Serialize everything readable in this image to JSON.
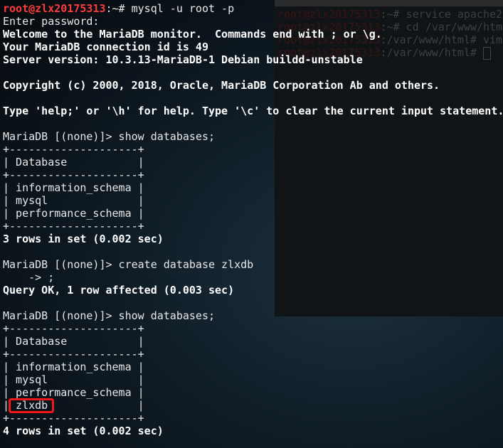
{
  "background_terminal": {
    "lines": [
      {
        "prompt": "root@zlx20175313",
        "rest": ":~# service apache2"
      },
      {
        "prompt": "root@zlx20175313",
        "rest": ":~# cd /var/www/html"
      },
      {
        "prompt": "root@zlx20175313",
        "rest": ":/var/www/html# vim"
      },
      {
        "prompt": "root@zlx20175313",
        "rest": ":/var/www/html# "
      }
    ]
  },
  "terminal": {
    "highlight_color": "#f01818",
    "lines": [
      {
        "prompt": "root@zlx20175313",
        "text": ":~# mysql -u root -p",
        "bold": false
      },
      {
        "text": "Enter password:",
        "bold": false
      },
      {
        "text": "Welcome to the MariaDB monitor.  Commands end with ; or \\g.",
        "bold": true
      },
      {
        "text": "Your MariaDB connection id is 49",
        "bold": true
      },
      {
        "text": "Server version: 10.3.13-MariaDB-1 Debian buildd-unstable",
        "bold": true
      },
      {
        "text": "",
        "bold": false
      },
      {
        "text": "Copyright (c) 2000, 2018, Oracle, MariaDB Corporation Ab and others.",
        "bold": true
      },
      {
        "text": "",
        "bold": false
      },
      {
        "text": "Type 'help;' or '\\h' for help. Type '\\c' to clear the current input statement.",
        "bold": true
      },
      {
        "text": "",
        "bold": false
      },
      {
        "text": "MariaDB [(none)]> show databases;",
        "bold": false
      },
      {
        "text": "+--------------------+",
        "bold": false
      },
      {
        "text": "| Database           |",
        "bold": false
      },
      {
        "text": "+--------------------+",
        "bold": false
      },
      {
        "text": "| information_schema |",
        "bold": false
      },
      {
        "text": "| mysql              |",
        "bold": false
      },
      {
        "text": "| performance_schema |",
        "bold": false
      },
      {
        "text": "+--------------------+",
        "bold": false
      },
      {
        "text": "3 rows in set (0.002 sec)",
        "bold": true
      },
      {
        "text": "",
        "bold": false
      },
      {
        "text": "MariaDB [(none)]> create database zlxdb",
        "bold": false
      },
      {
        "text": "    -> ;",
        "bold": false
      },
      {
        "text": "Query OK, 1 row affected (0.003 sec)",
        "bold": true
      },
      {
        "text": "",
        "bold": false
      },
      {
        "text": "MariaDB [(none)]> show databases;",
        "bold": false
      },
      {
        "text": "+--------------------+",
        "bold": false
      },
      {
        "text": "| Database           |",
        "bold": false
      },
      {
        "text": "+--------------------+",
        "bold": false
      },
      {
        "text": "| information_schema |",
        "bold": false
      },
      {
        "text": "| mysql              |",
        "bold": false
      },
      {
        "text": "| performance_schema |",
        "bold": false
      },
      {
        "text": "| zlxdb              |",
        "bold": false
      },
      {
        "text": "+--------------------+",
        "bold": false
      },
      {
        "text": "4 rows in set (0.002 sec)",
        "bold": true
      }
    ]
  }
}
